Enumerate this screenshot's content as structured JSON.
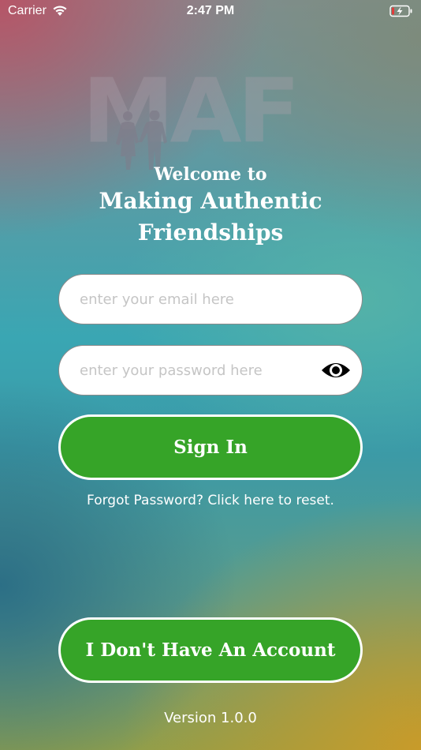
{
  "status_bar": {
    "carrier": "Carrier",
    "time": "2:47 PM",
    "icons": [
      "wifi-icon",
      "battery-charging-icon"
    ]
  },
  "logo": {
    "text": "MAF"
  },
  "welcome": {
    "line1": "Welcome to",
    "line2": "Making Authentic",
    "line3": "Friendships"
  },
  "form": {
    "email_placeholder": "enter your email here",
    "email_value": "",
    "password_placeholder": "enter your password here",
    "password_value": "",
    "show_password_icon": "eye-icon",
    "sign_in_label": "Sign In",
    "forgot_text": "Forgot Password? Click here to reset."
  },
  "no_account_label": "I Don't Have An Account",
  "version": "Version 1.0.0",
  "colors": {
    "button_green": "#36a428",
    "button_border": "#ffffff",
    "field_background": "#ffffff",
    "placeholder": "#c5c5c5"
  }
}
